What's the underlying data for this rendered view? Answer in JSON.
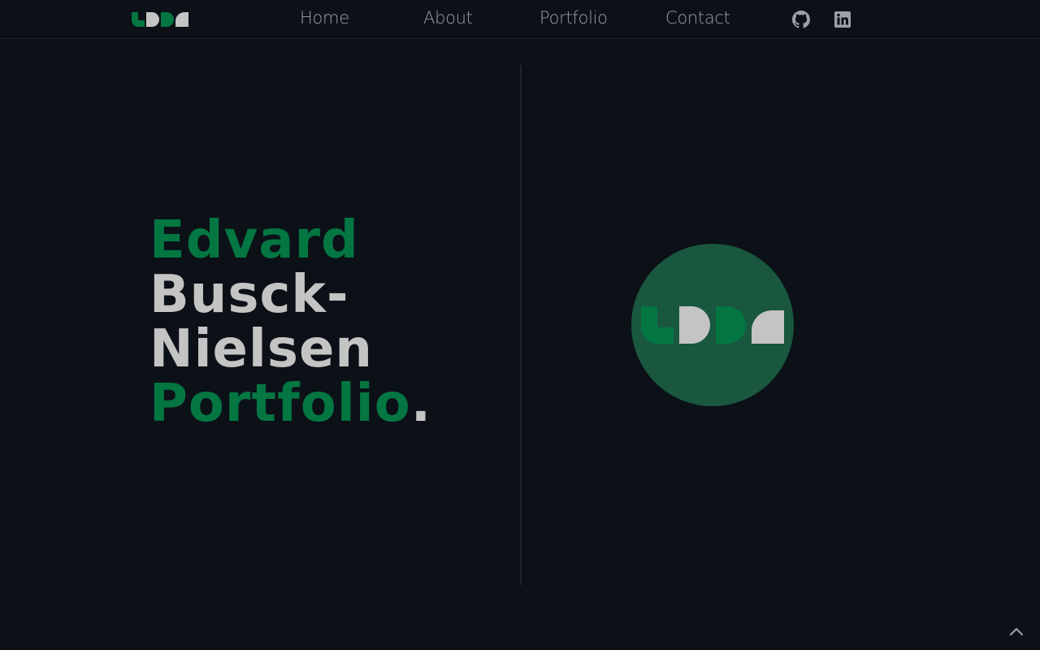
{
  "nav": {
    "links": [
      {
        "label": "Home"
      },
      {
        "label": "About"
      },
      {
        "label": "Portfolio"
      },
      {
        "label": "Contact"
      }
    ],
    "social": [
      "github-icon",
      "linkedin-icon"
    ]
  },
  "hero": {
    "title": {
      "line1": "Edvard",
      "line2": "Busck-",
      "line3": "Nielsen",
      "line4": "Portfolio",
      "period": "."
    }
  },
  "colors": {
    "background": "#0c1017",
    "accent_green": "#037642",
    "text_light": "#c4c4c4",
    "nav_text": "#9aa0a8",
    "circle": "#19573f"
  },
  "icons": {
    "scroll_top": "chevron-up-icon",
    "logo": "udda-logo"
  }
}
